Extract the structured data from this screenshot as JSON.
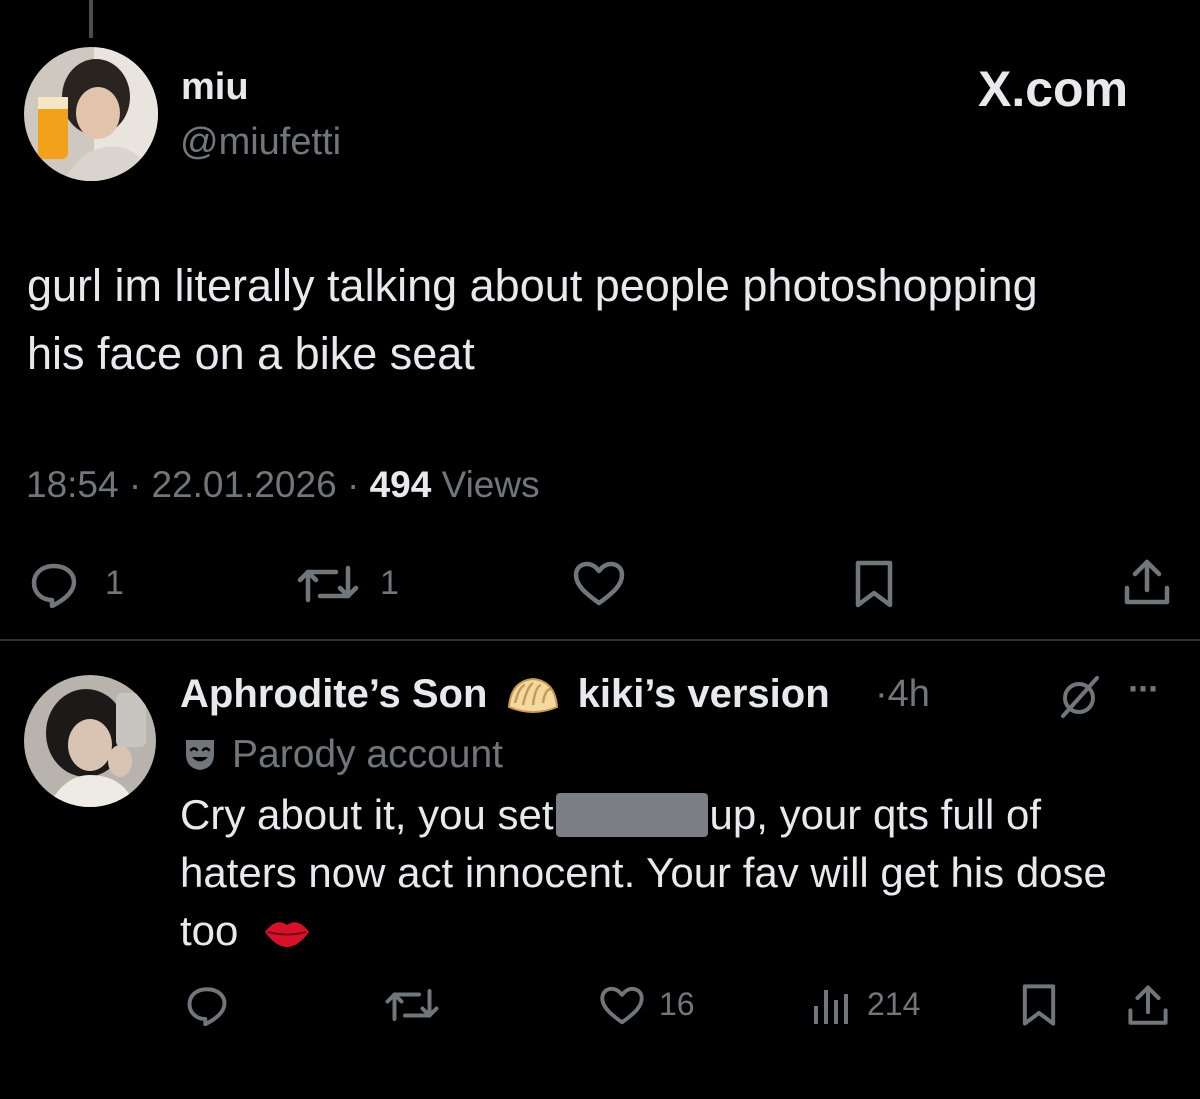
{
  "tweet": {
    "author_name": "miu",
    "author_handle": "@miufetti",
    "site_label": "X.com",
    "text_line1": "gurl im literally talking about people photoshopping",
    "text_line2": "his face on a bike seat",
    "time": "18:54",
    "date": "22.01.2026",
    "views_count": "494",
    "views_label": "Views",
    "sep": "·",
    "reply_count": "1",
    "repost_count": "1"
  },
  "reply": {
    "author_name": "Aphrodite’s Son",
    "author_name_suffix": "kiki’s version",
    "time": "4h",
    "sep": "·",
    "account_label": "Parody account",
    "text_part1": "Cry about it, you set",
    "text_part2": "up, your qts full of",
    "text_line2": "haters now act innocent. Your fav will get his dose",
    "text_line3": "too",
    "more_label": "···",
    "like_count": "16",
    "views_count": "214"
  },
  "colors": {
    "background": "#000000",
    "text": "#e7e9ea",
    "muted": "#71767b",
    "divider": "#2f3336"
  },
  "icons": [
    "reply-icon",
    "repost-icon",
    "like-icon",
    "bookmark-icon",
    "share-icon",
    "grok-icon",
    "more-icon",
    "views-icon",
    "dumpling-emoji",
    "parody-mask-icon",
    "lips-emoji"
  ]
}
